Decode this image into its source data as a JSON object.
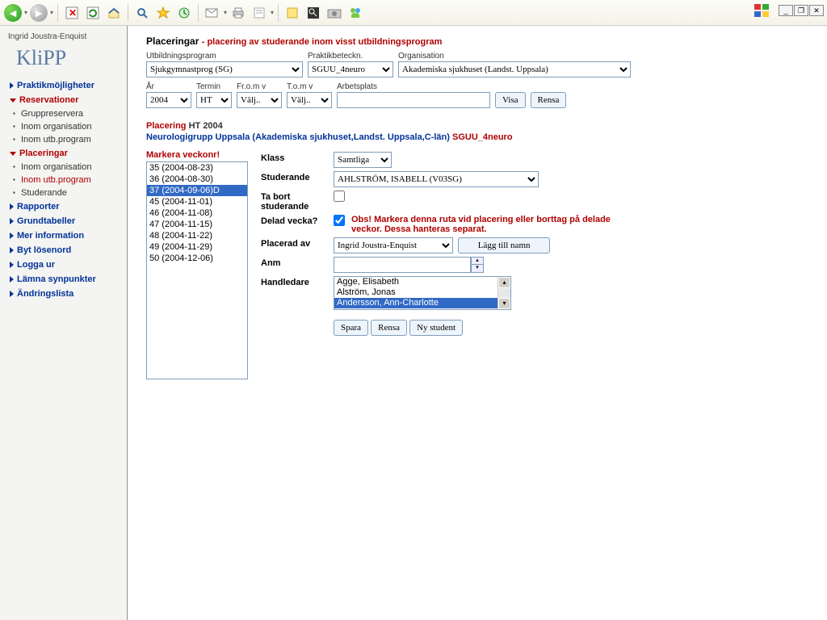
{
  "user": "Ingrid Joustra-Enquist",
  "app": "KliPP",
  "nav": {
    "praktik": "Praktikmöjligheter",
    "reserv": "Reservationer",
    "reserv_sub": [
      "Gruppreservera",
      "Inom organisation",
      "Inom utb.program"
    ],
    "placeringar": "Placeringar",
    "plac_sub": [
      "Inom organisation",
      "Inom utb.program",
      "Studerande"
    ],
    "rapporter": "Rapporter",
    "grundtabeller": "Grundtabeller",
    "merinfo": "Mer information",
    "bytlosen": "Byt lösenord",
    "loggaur": "Logga ur",
    "lamna": "Lämna synpunkter",
    "andring": "Ändringslista"
  },
  "header": {
    "title": "Placeringar",
    "subtitle": "- placering av studerande inom visst utbildningsprogram"
  },
  "filters": {
    "utbildningsprogram_label": "Utbildningsprogram",
    "utbildningsprogram": "Sjukgymnastprog (SG)",
    "praktik_label": "Praktikbeteckn.",
    "praktik": "SGUU_4neuro",
    "org_label": "Organisation",
    "org": "Akademiska sjukhuset (Landst. Uppsala)",
    "ar_label": "År",
    "ar": "2004",
    "termin_label": "Termin",
    "termin": "HT",
    "from_label": "Fr.o.m v",
    "from": "Välj..",
    "tom_label": "T.o.m v",
    "tom": "Välj..",
    "arbetsplats_label": "Arbetsplats",
    "visa": "Visa",
    "rensa": "Rensa"
  },
  "placering": {
    "prefix": "Placering",
    "term": "HT 2004",
    "group": "Neurologigrupp Uppsala",
    "location": "(Akademiska sjukhuset,Landst. Uppsala,C-län)",
    "code": "SGUU_4neuro"
  },
  "weeks": {
    "mark": "Markera veckonr!",
    "items": [
      "35 (2004-08-23)",
      "36 (2004-08-30)",
      "37 (2004-09-06)D",
      "45 (2004-11-01)",
      "46 (2004-11-08)",
      "47 (2004-11-15)",
      "48 (2004-11-22)",
      "49 (2004-11-29)",
      "50 (2004-12-06)"
    ],
    "selected_index": 2
  },
  "form": {
    "klass_label": "Klass",
    "klass": "Samtliga",
    "studerande_label": "Studerande",
    "studerande": "AHLSTRÖM, ISABELL (V03SG)",
    "tabort_label": "Ta bort studerande",
    "delad_label": "Delad vecka?",
    "delad_warn": "Obs! Markera denna ruta vid placering eller borttag på delade veckor. Dessa hanteras separat.",
    "placerad_label": "Placerad av",
    "placerad": "Ingrid Joustra-Enquist",
    "laggtill": "Lägg till namn",
    "anm_label": "Anm",
    "handledare_label": "Handledare",
    "handledare": [
      "Agge, Elisabeth",
      "Alström, Jonas",
      "Andersson, Ann-Charlotte"
    ],
    "handledare_sel": 2,
    "spara": "Spara",
    "rensa2": "Rensa",
    "nystudent": "Ny student"
  }
}
